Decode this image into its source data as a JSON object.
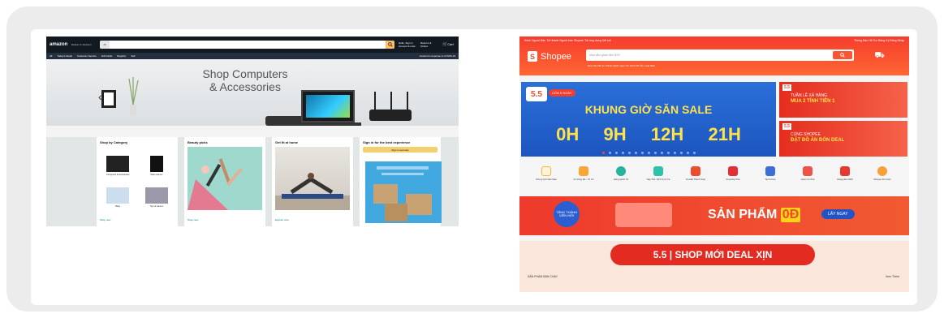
{
  "amazon": {
    "logo": "amazon",
    "location": "Deliver to Vietnam",
    "search_category": "All",
    "account": "Hello, Sign in Account & Lists",
    "orders": "Returns & Orders",
    "cart": "Cart",
    "nav": [
      "All",
      "Today's Deals",
      "Customer Service",
      "Gift Cards",
      "Registry",
      "Sell"
    ],
    "nav_right": "Amazon's response to COVID-19",
    "hero_title": "Shop Computers & Accessories",
    "cards": [
      {
        "title": "Shop by Category",
        "items": [
          "Computers & Accessories",
          "Video Games",
          "Baby",
          "Toys & Games"
        ],
        "link": "Shop now"
      },
      {
        "title": "Beauty picks",
        "link": "Shop now"
      },
      {
        "title": "Get fit at home",
        "link": "Explore now"
      },
      {
        "title": "Sign in for the best experience",
        "button": "Sign in securely"
      }
    ],
    "accent": "#febd69"
  },
  "shopee": {
    "top_left": "Kênh Người Bán   Trở thành Người bán Shopee   Tải ứng dụng   Kết nối",
    "top_right": "Thông Báo   Hỗ Trợ   Đăng Ký   Đăng Nhập",
    "logo": "Shopee",
    "search_placeholder": "Mua sắm giảm đến 50%",
    "sub_links": "Dép   Váy Nữ   Áo Khoác   Quần Jean   Túi Xách Nữ   Ốp Lưng   Balo",
    "banner": {
      "badge": "5.5",
      "days": "CÒN 5 NGÀY",
      "title": "KHUNG GIỜ SĂN SALE",
      "hours": [
        "0H",
        "9H",
        "12H",
        "21H"
      ]
    },
    "side_banners": [
      {
        "tag": "5.5",
        "line1": "TUẦN LỄ XẢ HÀNG",
        "line2": "MUA 2 TÍNH TIỀN 1"
      },
      {
        "tag": "5.5",
        "line1": "CÙNG SHOPEE",
        "line2": "ĐẶT ĐỒ ĂN ĐÓN DEAL"
      }
    ],
    "categories": [
      "Khung Giờ Săn Sale",
      "Gì Cũng Rẻ - Từ 1K",
      "Hàng Quốc Tế",
      "Nạp Thẻ, Dịch Vụ & Vé",
      "Ưu Đãi Thanh Toán",
      "Freeship Xtra",
      "Tech Zone",
      "Hoàn Xu Xtra",
      "Hàng Hiệu 50%",
      "Shopee Premium"
    ],
    "promo": {
      "badge": "TẶNG THÀNH VIÊN MỚI",
      "text": "SẢN PHẨM",
      "zero": "0Đ",
      "button": "LẤY NGAY"
    },
    "deal": "5.5 | SHOP MỚI DEAL XỊN",
    "deal_left": "SẢN PHẨM BÁN CHẠY",
    "deal_right": "Xem Thêm",
    "accent": "#ee4d2d"
  }
}
